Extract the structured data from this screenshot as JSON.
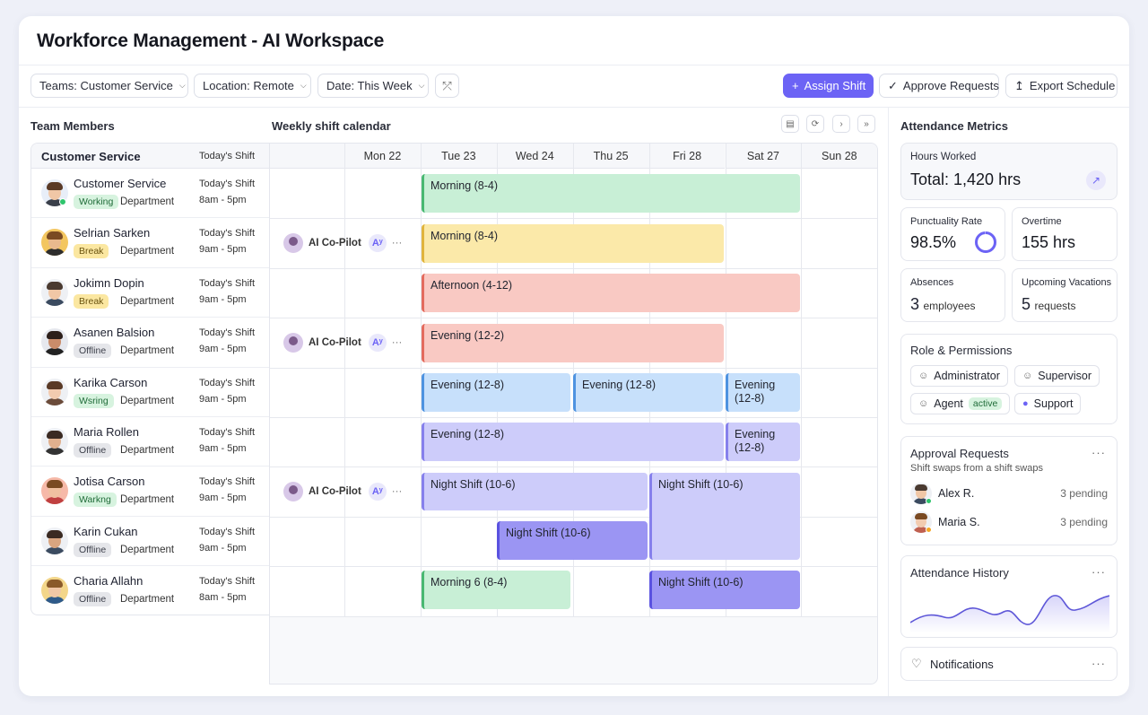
{
  "app": {
    "title": "Workforce Management - AI Workspace"
  },
  "toolbar": {
    "filters": [
      {
        "label": "Teams: Customer Service"
      },
      {
        "label": "Location: Remote"
      },
      {
        "label": "Date: This Week"
      }
    ],
    "actions": {
      "assign": "Assign Shift",
      "approve": "Approve Requests",
      "export": "Export Schedule"
    }
  },
  "team": {
    "section_title": "Team Members",
    "group_label": "Customer Service",
    "shift_header": "Today's Shift",
    "members": [
      {
        "name": "Customer Service",
        "status": "Working",
        "dept": "Department",
        "shift_label": "Today's Shift",
        "shift_time": "8am - 5pm"
      },
      {
        "name": "Selrian Sarken",
        "status": "Break",
        "dept": "Department",
        "shift_label": "Today's Shift",
        "shift_time": "9am - 5pm"
      },
      {
        "name": "Jokimn Dopin",
        "status": "Break",
        "dept": "Department",
        "shift_label": "Today's Shift",
        "shift_time": "9am - 5pm"
      },
      {
        "name": "Asanen Balsion",
        "status": "Offline",
        "dept": "Department",
        "shift_label": "Today's Shift",
        "shift_time": "9am - 5pm"
      },
      {
        "name": "Karika Carson",
        "status": "Wsring",
        "dept": "Department",
        "shift_label": "Today's Shift",
        "shift_time": "9am - 5pm"
      },
      {
        "name": "Maria Rollen",
        "status": "Offline",
        "dept": "Department",
        "shift_label": "Today's Shift",
        "shift_time": "9am - 5pm"
      },
      {
        "name": "Jotisa Carson",
        "status": "Warkng",
        "dept": "Department",
        "shift_label": "Today's Shift",
        "shift_time": "9am - 5pm"
      },
      {
        "name": "Karin Cukan",
        "status": "Offline",
        "dept": "Department",
        "shift_label": "Today's Shift",
        "shift_time": "9am - 5pm"
      },
      {
        "name": "Charia Allahn",
        "status": "Offline",
        "dept": "Department",
        "shift_label": "Today's Shift",
        "shift_time": "8am - 5pm"
      }
    ]
  },
  "calendar": {
    "title": "Weekly shift calendar",
    "days": [
      "Mon 22",
      "Tue 23",
      "Wed 24",
      "Thu 25",
      "Fri 28",
      "Sat 27",
      "Sun 28"
    ],
    "copilot": {
      "label": "AI Co-Pilot",
      "badge": "Aʸ"
    },
    "shifts": {
      "r1": "Morning (8-4)",
      "r2": "Morning (8-4)",
      "r3": "Afternoon (4-12)",
      "r4": "Evening (12-2)",
      "r5a": "Evening (12-8)",
      "r5b": "Evening (12-8)",
      "r5c": "Evening (12-8)",
      "r6a": "Evening (12-8)",
      "r6b": "Evening (12-8)",
      "r7a": "Night Shift (10-6)",
      "r7b": "Night Shift (10-6)",
      "r8": "Night Shift (10-6)",
      "r9a": "Morning 6 (8-4)",
      "r9b": "Night Shift (10-6)"
    }
  },
  "metrics": {
    "title": "Attendance Metrics",
    "hours": {
      "label": "Hours Worked",
      "value": "Total: 1,420 hrs"
    },
    "punctuality": {
      "label": "Punctuality Rate",
      "value": "98.5%",
      "ring_fraction": 0.985
    },
    "overtime": {
      "label": "Overtime",
      "value": "155 hrs"
    },
    "absences": {
      "label": "Absences",
      "num": "3",
      "unit": "employees"
    },
    "vacations": {
      "label": "Upcoming Vacations",
      "num": "5",
      "unit": "requests"
    }
  },
  "roles": {
    "title": "Role & Permissions",
    "items": {
      "admin": "Administrator",
      "supervisor": "Supervisor",
      "agent": "Agent",
      "agent_badge": "active",
      "support": "Support"
    }
  },
  "approvals": {
    "title": "Approval Requests",
    "subtitle": "Shift swaps from a shift swaps",
    "items": [
      {
        "name": "Alex R.",
        "count": "3 pending"
      },
      {
        "name": "Maria S.",
        "count": "3 pending"
      }
    ]
  },
  "history": {
    "title": "Attendance History"
  },
  "notifications": {
    "title": "Notifications"
  },
  "colors": {
    "accent": "#6c63f5",
    "working": "#2ec46c"
  }
}
